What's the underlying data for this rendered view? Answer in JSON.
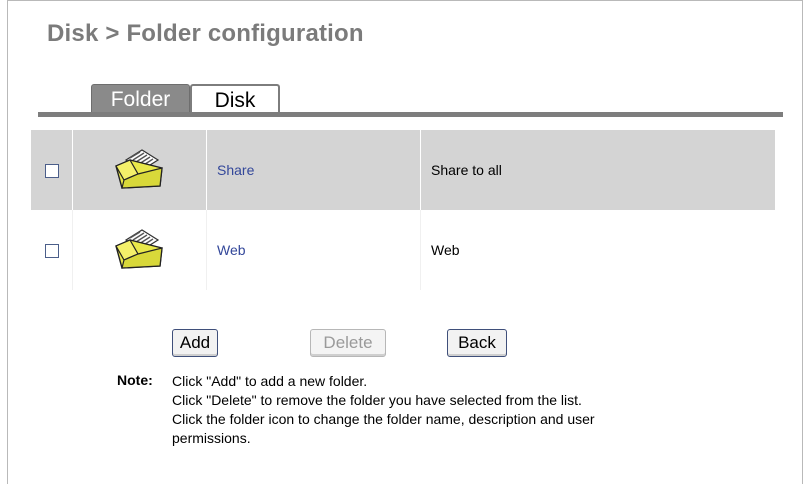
{
  "page": {
    "title": "Disk > Folder configuration"
  },
  "tabs": [
    {
      "label": "Folder",
      "active": true
    },
    {
      "label": "Disk",
      "active": false
    }
  ],
  "folders": [
    {
      "name": "Share",
      "description": "Share to all",
      "checked": false
    },
    {
      "name": "Web",
      "description": "Web",
      "checked": false
    }
  ],
  "buttons": {
    "add": "Add",
    "delete": "Delete",
    "back": "Back"
  },
  "note": {
    "label": "Note:",
    "lines": [
      "Click \"Add\" to add a new folder.",
      "Click \"Delete\" to remove the folder you have selected from the list.",
      "Click the folder icon to change the folder name, description and user",
      "permissions."
    ]
  },
  "colors": {
    "title": "#7b7b7b",
    "tab_active_bg": "#8a8a8a",
    "row_highlight": "#d4d4d4",
    "link": "#33479a"
  },
  "icons": {
    "folder": "open-folder-icon",
    "checkbox": "checkbox-unchecked-icon"
  }
}
